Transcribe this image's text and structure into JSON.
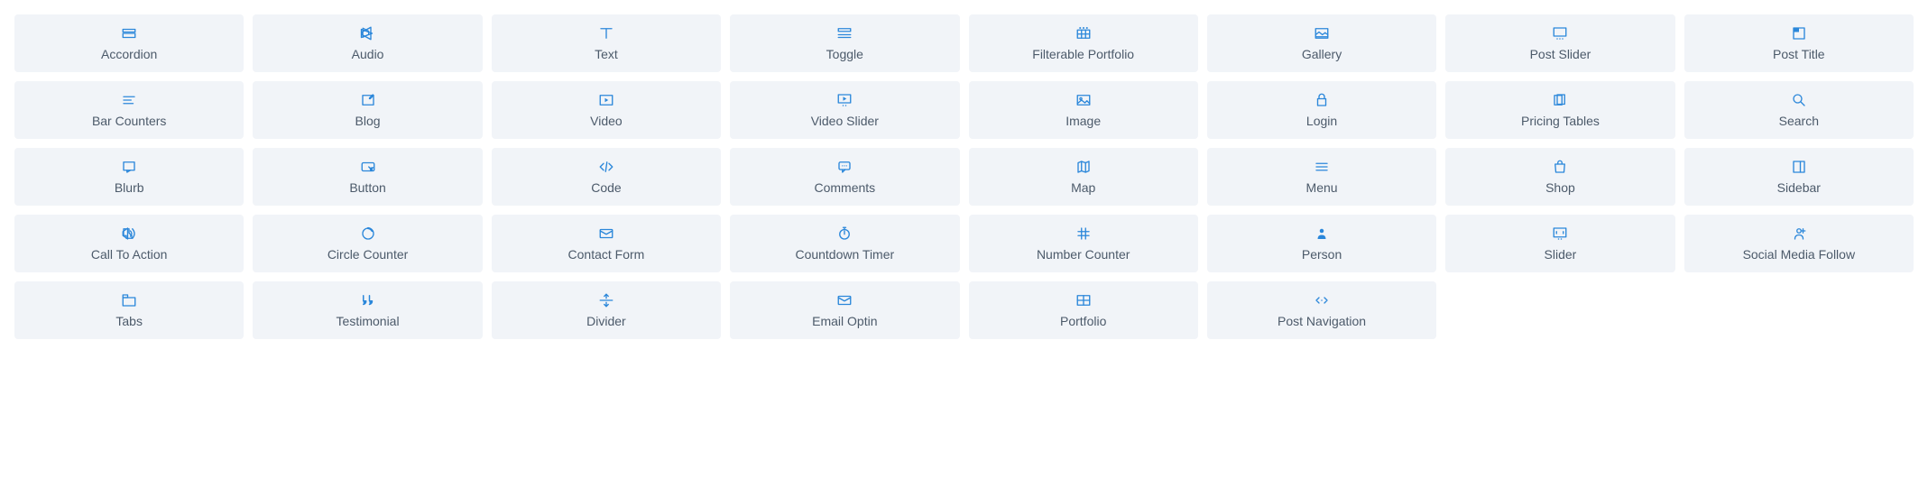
{
  "modules": [
    {
      "id": "accordion",
      "label": "Accordion",
      "icon": "accordion"
    },
    {
      "id": "audio",
      "label": "Audio",
      "icon": "audio"
    },
    {
      "id": "text",
      "label": "Text",
      "icon": "text"
    },
    {
      "id": "toggle",
      "label": "Toggle",
      "icon": "toggle"
    },
    {
      "id": "filterable-portfolio",
      "label": "Filterable Portfolio",
      "icon": "filterable-portfolio"
    },
    {
      "id": "gallery",
      "label": "Gallery",
      "icon": "gallery"
    },
    {
      "id": "post-slider",
      "label": "Post Slider",
      "icon": "post-slider"
    },
    {
      "id": "post-title",
      "label": "Post Title",
      "icon": "post-title"
    },
    {
      "id": "bar-counters",
      "label": "Bar Counters",
      "icon": "bar-counters"
    },
    {
      "id": "blog",
      "label": "Blog",
      "icon": "blog"
    },
    {
      "id": "video",
      "label": "Video",
      "icon": "video"
    },
    {
      "id": "video-slider",
      "label": "Video Slider",
      "icon": "video-slider"
    },
    {
      "id": "image",
      "label": "Image",
      "icon": "image"
    },
    {
      "id": "login",
      "label": "Login",
      "icon": "login"
    },
    {
      "id": "pricing-tables",
      "label": "Pricing Tables",
      "icon": "pricing-tables"
    },
    {
      "id": "search",
      "label": "Search",
      "icon": "search"
    },
    {
      "id": "blurb",
      "label": "Blurb",
      "icon": "blurb"
    },
    {
      "id": "button",
      "label": "Button",
      "icon": "button"
    },
    {
      "id": "code",
      "label": "Code",
      "icon": "code"
    },
    {
      "id": "comments",
      "label": "Comments",
      "icon": "comments"
    },
    {
      "id": "map",
      "label": "Map",
      "icon": "map"
    },
    {
      "id": "menu",
      "label": "Menu",
      "icon": "menu"
    },
    {
      "id": "shop",
      "label": "Shop",
      "icon": "shop"
    },
    {
      "id": "sidebar",
      "label": "Sidebar",
      "icon": "sidebar"
    },
    {
      "id": "call-to-action",
      "label": "Call To Action",
      "icon": "call-to-action"
    },
    {
      "id": "circle-counter",
      "label": "Circle Counter",
      "icon": "circle-counter"
    },
    {
      "id": "contact-form",
      "label": "Contact Form",
      "icon": "contact-form"
    },
    {
      "id": "countdown-timer",
      "label": "Countdown Timer",
      "icon": "countdown-timer"
    },
    {
      "id": "number-counter",
      "label": "Number Counter",
      "icon": "number-counter"
    },
    {
      "id": "person",
      "label": "Person",
      "icon": "person"
    },
    {
      "id": "slider",
      "label": "Slider",
      "icon": "slider"
    },
    {
      "id": "social-media-follow",
      "label": "Social Media Follow",
      "icon": "social-media-follow"
    },
    {
      "id": "tabs",
      "label": "Tabs",
      "icon": "tabs"
    },
    {
      "id": "testimonial",
      "label": "Testimonial",
      "icon": "testimonial"
    },
    {
      "id": "divider",
      "label": "Divider",
      "icon": "divider"
    },
    {
      "id": "email-optin",
      "label": "Email Optin",
      "icon": "email-optin"
    },
    {
      "id": "portfolio",
      "label": "Portfolio",
      "icon": "portfolio"
    },
    {
      "id": "post-navigation",
      "label": "Post Navigation",
      "icon": "post-navigation"
    }
  ],
  "colors": {
    "icon": "#2b87da",
    "cardBackground": "#f1f4f8",
    "labelText": "#4c5a6a"
  }
}
